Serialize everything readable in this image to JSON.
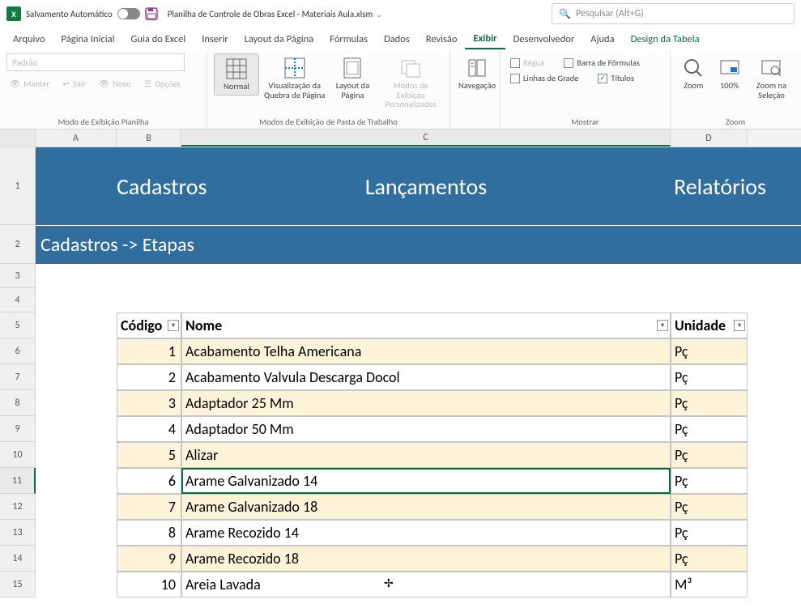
{
  "titlebar": {
    "autosave_label": "Salvamento Automático",
    "filename": "Planilha de Controle de Obras Excel - Materiais Aula.xlsm",
    "search_placeholder": "Pesquisar (Alt+G)"
  },
  "menu": {
    "arquivo": "Arquivo",
    "pagina_inicial": "Página Inicial",
    "guia_excel": "Guia do Excel",
    "inserir": "Inserir",
    "layout": "Layout da Página",
    "formulas": "Fórmulas",
    "dados": "Dados",
    "revisao": "Revisão",
    "exibir": "Exibir",
    "desenvolvedor": "Desenvolvedor",
    "ajuda": "Ajuda",
    "design_tabela": "Design da Tabela"
  },
  "ribbon": {
    "wb_view": {
      "dropdown": "Padrão",
      "manter": "Manter",
      "sair": "Sair",
      "novo": "Novo",
      "opcoes": "Opções",
      "group": "Modo de Exibição Planilha"
    },
    "views": {
      "normal": "Normal",
      "quebra": "Visualização da Quebra de Página",
      "layout": "Layout da Página",
      "custom": "Modos de Exibição Personalizados",
      "group": "Modos de Exibição de Pasta de Trabalho"
    },
    "nav": {
      "navegacao": "Navegação"
    },
    "show": {
      "regua": "Régua",
      "barra": "Barra de Fórmulas",
      "grade": "Linhas de Grade",
      "titulos": "Títulos",
      "group": "Mostrar"
    },
    "zoom": {
      "zoom": "Zoom",
      "cem": "100%",
      "selecao": "Zoom na Seleção",
      "group": "Zoom"
    }
  },
  "cols": {
    "A": "A",
    "B": "B",
    "C": "C",
    "D": "D"
  },
  "rows": [
    "1",
    "2",
    "3",
    "4",
    "5",
    "6",
    "7",
    "8",
    "9",
    "10",
    "11",
    "12",
    "13",
    "14",
    "15"
  ],
  "banner": {
    "cadastros": "Cadastros",
    "lancamentos": "Lançamentos",
    "relatorios": "Relatórios",
    "breadcrumb": "Cadastros -> Etapas"
  },
  "table": {
    "headers": {
      "codigo": "Código",
      "nome": "Nome",
      "unidade": "Unidade"
    },
    "rows": [
      {
        "codigo": "1",
        "nome": "Acabamento Telha Americana",
        "unidade": "Pç"
      },
      {
        "codigo": "2",
        "nome": "Acabamento Valvula Descarga Docol",
        "unidade": "Pç"
      },
      {
        "codigo": "3",
        "nome": "Adaptador 25 Mm",
        "unidade": "Pç"
      },
      {
        "codigo": "4",
        "nome": "Adaptador 50 Mm",
        "unidade": "Pç"
      },
      {
        "codigo": "5",
        "nome": "Alizar",
        "unidade": "Pç"
      },
      {
        "codigo": "6",
        "nome": "Arame Galvanizado 14",
        "unidade": "Pç"
      },
      {
        "codigo": "7",
        "nome": "Arame Galvanizado 18",
        "unidade": "Pç"
      },
      {
        "codigo": "8",
        "nome": "Arame Recozido 14",
        "unidade": "Pç"
      },
      {
        "codigo": "9",
        "nome": "Arame Recozido 18",
        "unidade": "Pç"
      },
      {
        "codigo": "10",
        "nome": "Areia Lavada",
        "unidade": "M³"
      }
    ]
  }
}
